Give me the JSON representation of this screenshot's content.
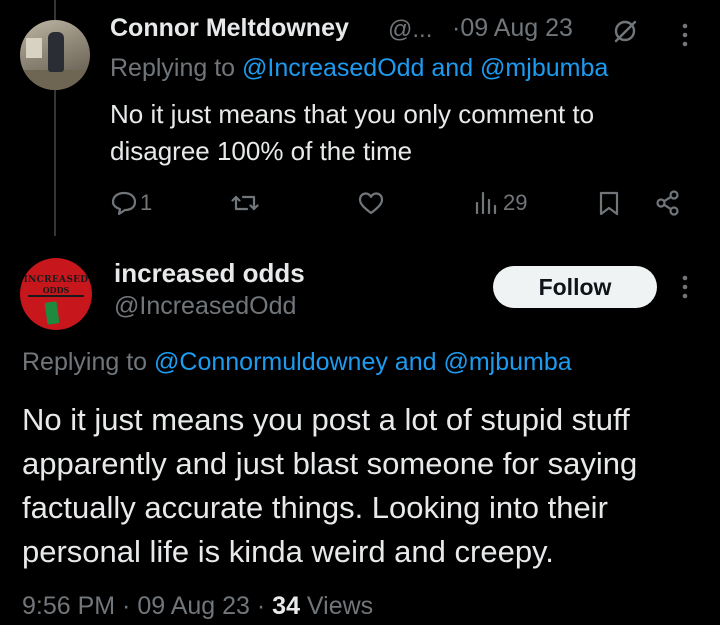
{
  "parent_tweet": {
    "author_name": "Connor Meltdowney",
    "author_handle": "@...",
    "separator": "·",
    "date": "09 Aug 23",
    "replying_prefix": "Replying to ",
    "replying_to": "@IncreasedOdd and @mjbumba",
    "text": "No it just means that you only comment to disagree 100% of the time",
    "reply_count": "1",
    "views_count": "29"
  },
  "main_tweet": {
    "author_name": "increased odds",
    "author_handle": "@IncreasedOdd",
    "follow_label": "Follow",
    "replying_prefix": "Replying to ",
    "replying_to": "@Connormuldowney and @mjbumba",
    "text": "No it just means you post a lot of stupid stuff apparently and just blast someone for saying factually accurate things. Looking into their personal life is kinda weird and creepy.",
    "time": "9:56 PM",
    "sep1": " · ",
    "date": "09 Aug 23",
    "sep2": " · ",
    "views_count": "34",
    "views_label": " Views",
    "avatar_text_line1": "INCREASED",
    "avatar_text_line2": "ODDS"
  },
  "colors": {
    "background": "#000000",
    "text_primary": "#e7e9ea",
    "text_secondary": "#71767b",
    "link": "#1d9bf0",
    "follow_button_bg": "#eff3f4"
  },
  "icons": {
    "reply": "speech-bubble-icon",
    "retweet": "retweet-icon",
    "like": "heart-icon",
    "views": "bar-chart-icon",
    "bookmark": "bookmark-icon",
    "share": "share-icon",
    "grok": "grok-icon",
    "more": "more-vertical-icon"
  }
}
